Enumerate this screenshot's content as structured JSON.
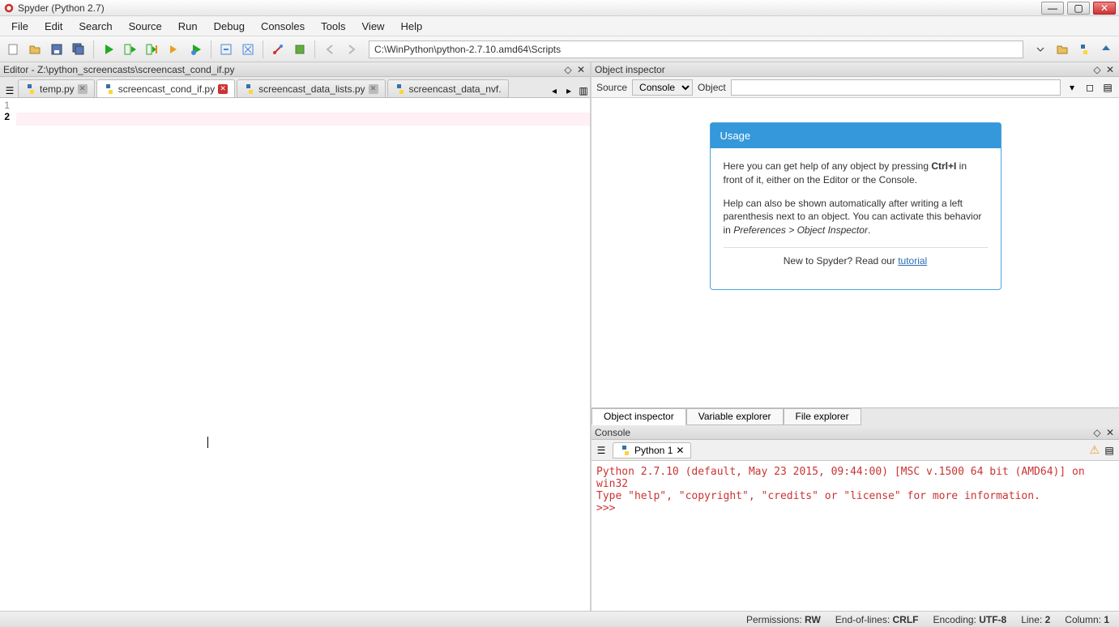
{
  "window": {
    "title": "Spyder (Python 2.7)"
  },
  "menu": [
    "File",
    "Edit",
    "Search",
    "Source",
    "Run",
    "Debug",
    "Consoles",
    "Tools",
    "View",
    "Help"
  ],
  "toolbar": {
    "path": "C:\\WinPython\\python-2.7.10.amd64\\Scripts"
  },
  "editor": {
    "pane_title": "Editor - Z:\\python_screencasts\\screencast_cond_if.py",
    "tabs": [
      {
        "label": "temp.py",
        "active": false,
        "dirty": false
      },
      {
        "label": "screencast_cond_if.py",
        "active": true,
        "dirty": true
      },
      {
        "label": "screencast_data_lists.py",
        "active": false,
        "dirty": false
      },
      {
        "label": "screencast_data_nvf.",
        "active": false,
        "dirty": false
      }
    ],
    "lines": [
      "1",
      "2"
    ],
    "current_line": 2
  },
  "inspector": {
    "pane_title": "Object inspector",
    "source_label": "Source",
    "source_value": "Console",
    "object_label": "Object",
    "object_value": "",
    "usage": {
      "header": "Usage",
      "p1_pre": "Here you can get help of any object by pressing ",
      "p1_key": "Ctrl+I",
      "p1_post": " in front of it, either on the Editor or the Console.",
      "p2_pre": "Help can also be shown automatically after writing a left parenthesis next to an object. You can activate this behavior in ",
      "p2_em": "Preferences > Object Inspector",
      "p2_post": ".",
      "p3_pre": "New to Spyder? Read our ",
      "p3_link": "tutorial"
    },
    "bottom_tabs": [
      "Object inspector",
      "Variable explorer",
      "File explorer"
    ]
  },
  "console": {
    "pane_title": "Console",
    "tab_label": "Python 1",
    "output": "Python 2.7.10 (default, May 23 2015, 09:44:00) [MSC v.1500 64 bit (AMD64)] on win32\nType \"help\", \"copyright\", \"credits\" or \"license\" for more information.\n>>> "
  },
  "status": {
    "permissions_label": "Permissions:",
    "permissions_value": "RW",
    "eol_label": "End-of-lines:",
    "eol_value": "CRLF",
    "encoding_label": "Encoding:",
    "encoding_value": "UTF-8",
    "line_label": "Line:",
    "line_value": "2",
    "col_label": "Column:",
    "col_value": "1"
  }
}
